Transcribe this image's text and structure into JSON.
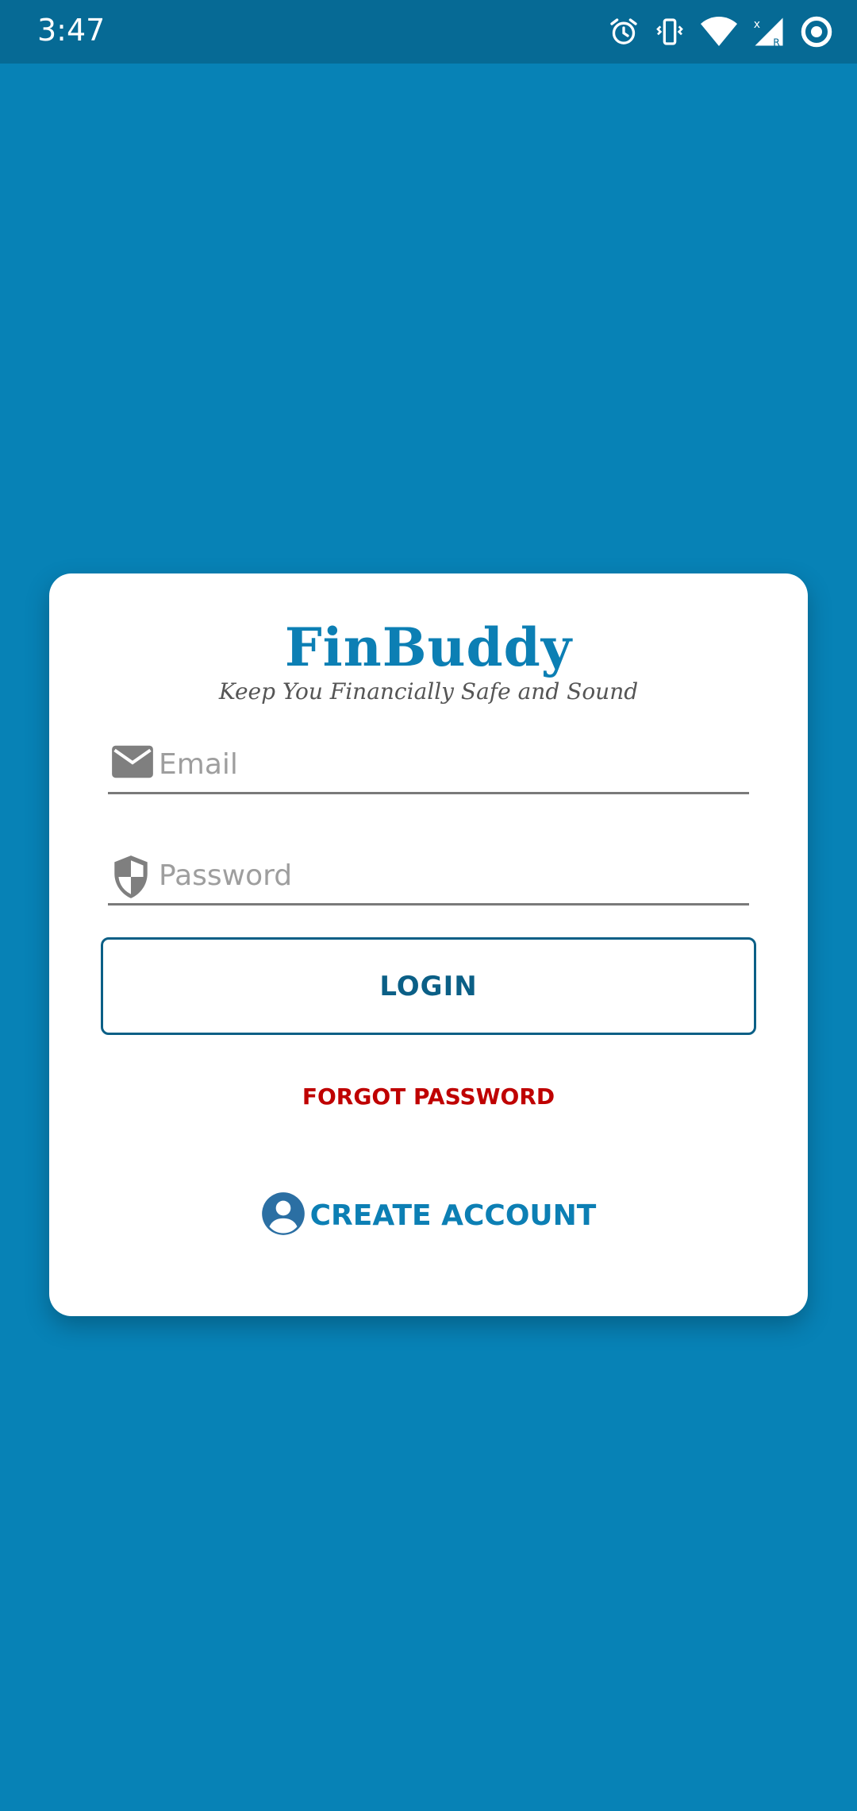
{
  "status_bar": {
    "time": "3:47",
    "icons": [
      "alarm-icon",
      "vibrate-icon",
      "wifi-icon",
      "cell-signal-icon",
      "sync-icon"
    ]
  },
  "login_card": {
    "title": "FinBuddy",
    "tagline": "Keep You Financially Safe and Sound",
    "email": {
      "icon": "mail-icon",
      "value": "",
      "placeholder": "Email"
    },
    "password": {
      "icon": "shield-icon",
      "value": "",
      "placeholder": "Password"
    },
    "login_label": "LOGIN",
    "forgot_label": "FORGOT PASSWORD",
    "create_account": {
      "icon": "account-circle-icon",
      "label": "CREATE ACCOUNT"
    }
  },
  "colors": {
    "background": "#0782b6",
    "status_bar": "#066a95",
    "card": "#ffffff",
    "brand": "#0c7fb4",
    "login_border": "#0b5f86",
    "forgot": "#bf0000",
    "icon_gray": "#7f7f7f"
  }
}
